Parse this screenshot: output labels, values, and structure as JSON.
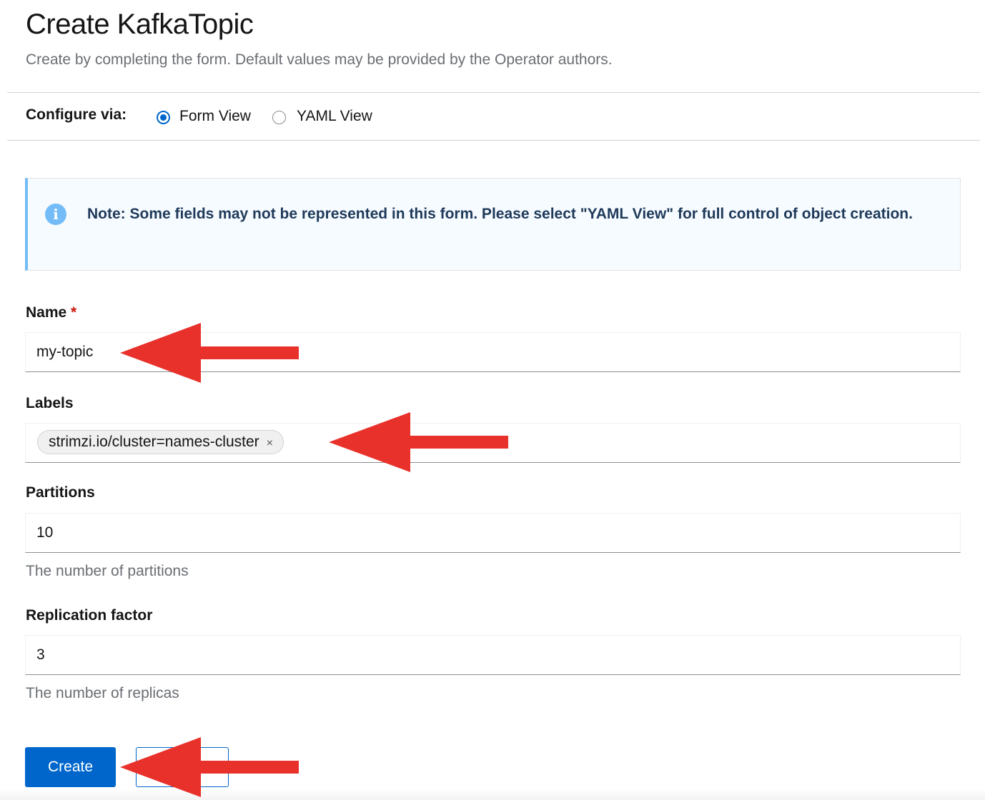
{
  "header": {
    "title": "Create KafkaTopic",
    "subtitle": "Create by completing the form. Default values may be provided by the Operator authors."
  },
  "configure": {
    "label": "Configure via:",
    "options": [
      "Form View",
      "YAML View"
    ],
    "selected": "Form View"
  },
  "alert": {
    "text": "Note: Some fields may not be represented in this form. Please select \"YAML View\" for full control of object creation."
  },
  "form": {
    "name": {
      "label": "Name",
      "required_marker": "*",
      "value": "my-topic"
    },
    "labels": {
      "label": "Labels",
      "chip": "strimzi.io/cluster=names-cluster",
      "chip_close": "×"
    },
    "partitions": {
      "label": "Partitions",
      "value": "10",
      "helper": "The number of partitions"
    },
    "replication": {
      "label": "Replication factor",
      "value": "3",
      "helper": "The number of replicas"
    }
  },
  "actions": {
    "create_label": "Create",
    "cancel_label": "Cancel"
  },
  "colors": {
    "primary": "#0066cc",
    "annotation_arrow": "#e8312a",
    "alert_border": "#73bcf7"
  }
}
